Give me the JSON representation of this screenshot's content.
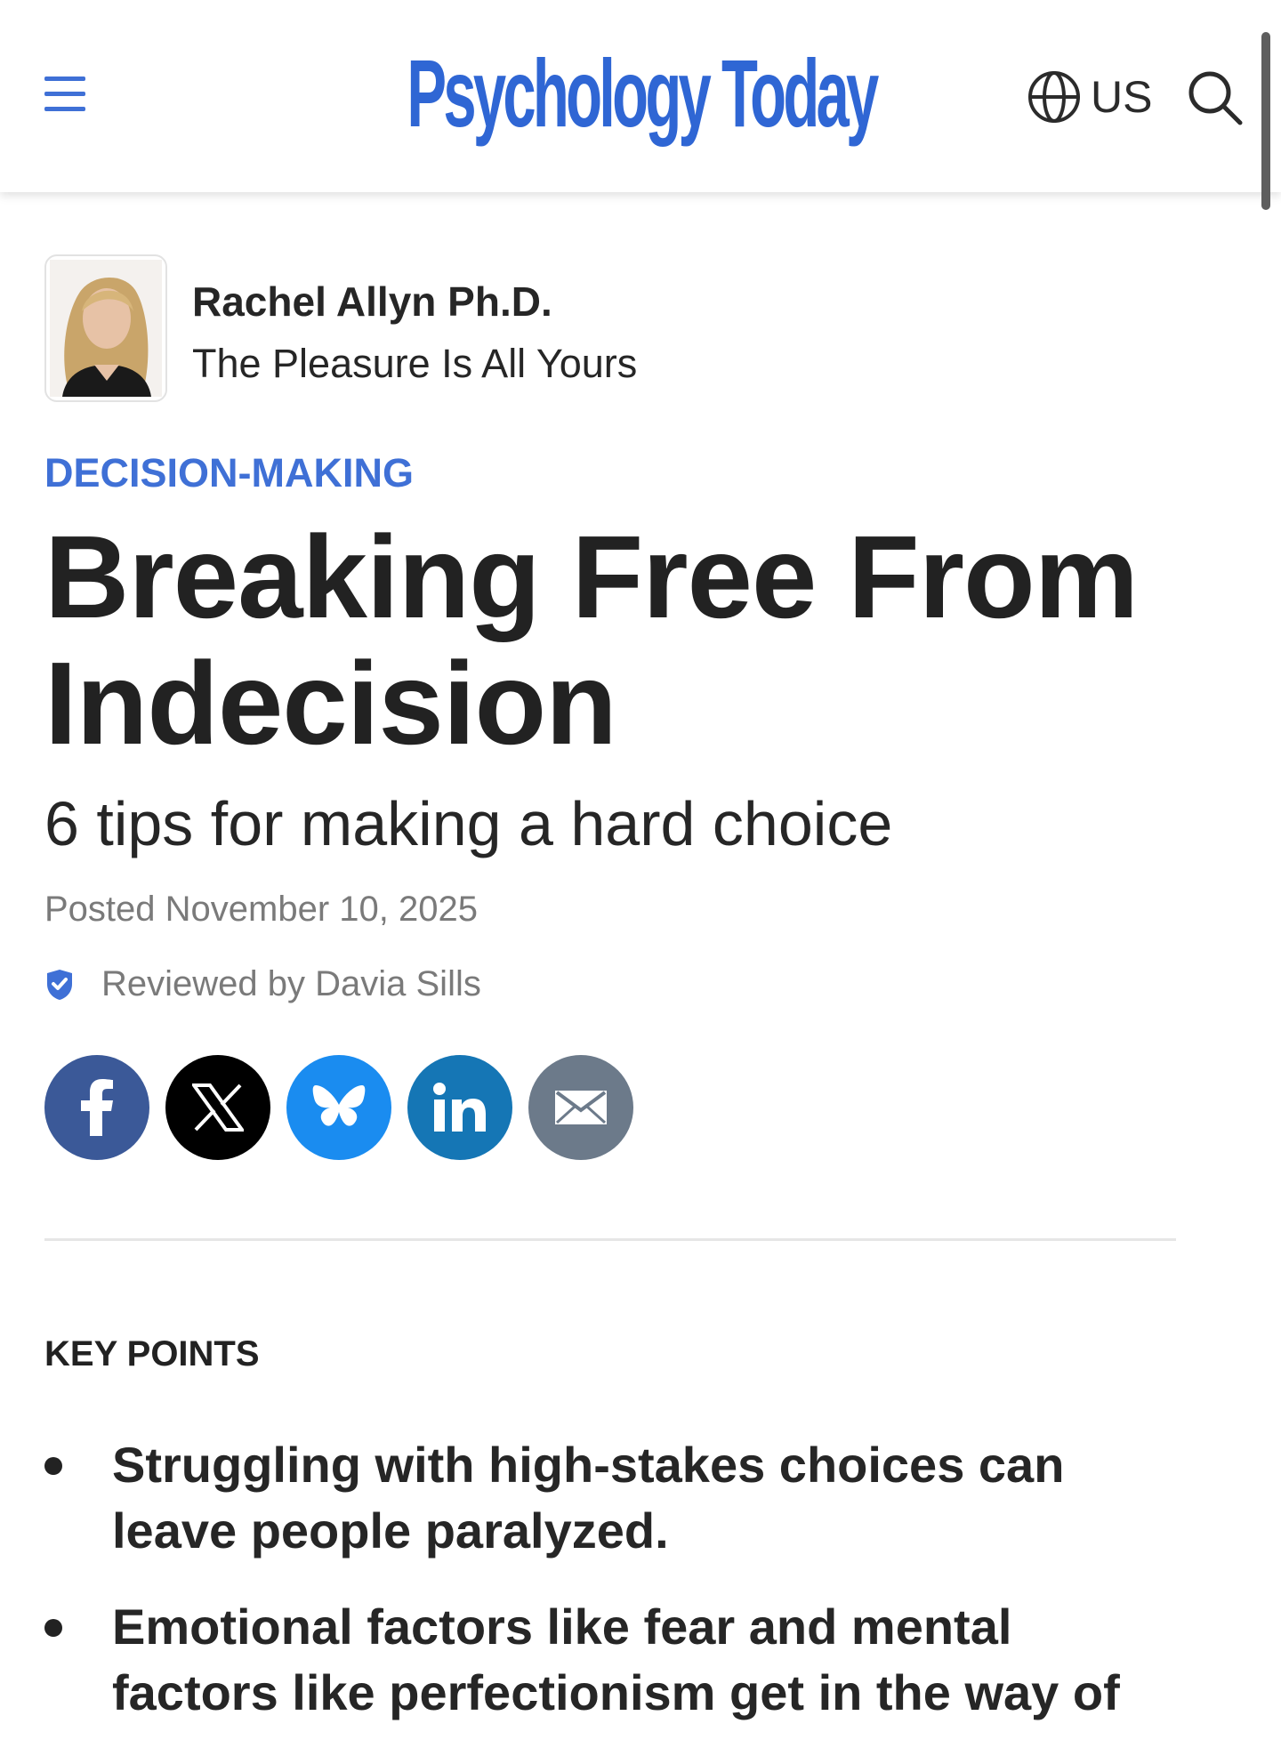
{
  "header": {
    "logo_text": "Psychology Today",
    "region_label": "US",
    "menu_icon": "hamburger-menu-icon",
    "globe_icon": "globe-icon",
    "search_icon": "search-icon",
    "brand_color": "#2f66d4"
  },
  "author": {
    "name": "Rachel Allyn Ph.D.",
    "blog": "The Pleasure Is All Yours"
  },
  "article": {
    "category": "DECISION-MAKING",
    "title": "Breaking Free From Indecision",
    "subtitle": "6 tips for making a hard choice",
    "posted": "Posted November 10, 2025",
    "reviewed": "Reviewed by Davia Sills"
  },
  "share": [
    {
      "network": "facebook",
      "icon": "facebook-icon",
      "color": "#3b5998"
    },
    {
      "network": "x",
      "icon": "x-icon",
      "color": "#000000"
    },
    {
      "network": "bluesky",
      "icon": "bluesky-icon",
      "color": "#1a8cf0"
    },
    {
      "network": "linkedin",
      "icon": "linkedin-icon",
      "color": "#1576b5"
    },
    {
      "network": "email",
      "icon": "email-icon",
      "color": "#6c7a8a"
    }
  ],
  "key_points": {
    "heading": "KEY POINTS",
    "items": [
      "Struggling with high-stakes choices can leave people paralyzed.",
      "Emotional factors like fear and mental factors like perfectionism get in the way of"
    ]
  }
}
